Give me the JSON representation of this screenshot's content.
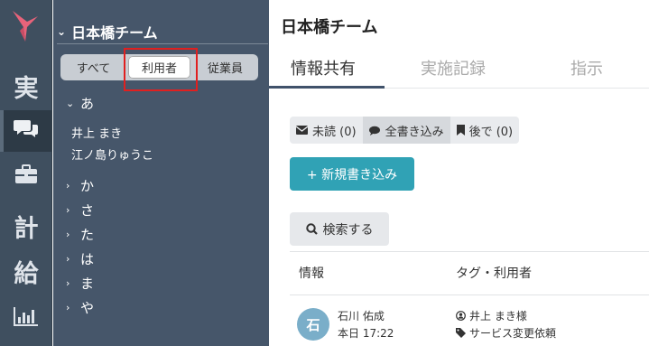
{
  "rail": {
    "logo": "bird-logo",
    "items": [
      {
        "label": "実",
        "icon": ""
      },
      {
        "label": "",
        "icon": "chat-icon"
      },
      {
        "label": "",
        "icon": "briefcase-icon"
      },
      {
        "label": "計",
        "icon": ""
      },
      {
        "label": "給",
        "icon": ""
      },
      {
        "label": "",
        "icon": "bar-chart-icon"
      }
    ]
  },
  "sidebar": {
    "team_name": "日本橋チーム",
    "segments": [
      "すべて",
      "利用者",
      "従業員"
    ],
    "selected_segment": "利用者",
    "groups": [
      {
        "label": "あ",
        "expanded": true,
        "members": [
          "井上 まき",
          "江ノ島りゅうこ"
        ]
      },
      {
        "label": "か",
        "expanded": false
      },
      {
        "label": "さ",
        "expanded": false
      },
      {
        "label": "た",
        "expanded": false
      },
      {
        "label": "は",
        "expanded": false
      },
      {
        "label": "ま",
        "expanded": false
      },
      {
        "label": "や",
        "expanded": false
      }
    ]
  },
  "main": {
    "title": "日本橋チーム",
    "tabs": [
      "情報共有",
      "実施記録",
      "指示"
    ],
    "active_tab": "情報共有",
    "filters": [
      "未読 (0)",
      "全書き込み",
      "後で (0)"
    ],
    "active_filter": "全書き込み",
    "new_post_label": "+ 新規書き込み",
    "search_label": "検索する",
    "table": {
      "headers": [
        "情報",
        "タグ・利用者"
      ],
      "rows": [
        {
          "avatar": "石",
          "author": "石川 佑成",
          "time": "本日 17:22",
          "user_tag": "井上 まき様",
          "tag": "サービス変更依頼"
        }
      ]
    }
  },
  "colors": {
    "rail_bg": "#3f4f5f",
    "sidebar_bg": "#46566a",
    "accent": "#30a2b5",
    "logo": "#e8637a",
    "highlight": "#e02020",
    "avatar_bg": "#7aaec9"
  }
}
